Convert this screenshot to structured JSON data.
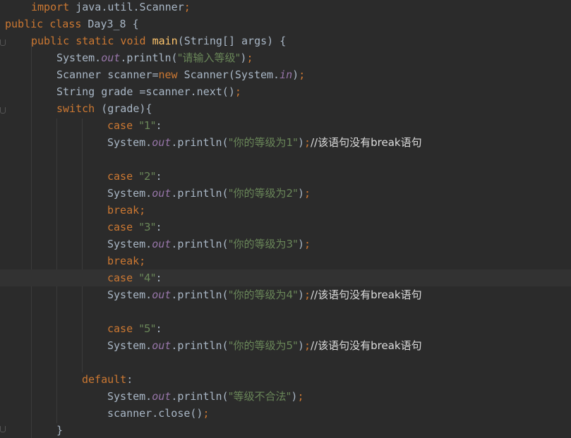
{
  "editor": {
    "lines": [
      {
        "indent": 44,
        "tokens": [
          {
            "t": "kw",
            "v": "import "
          },
          {
            "t": "p",
            "v": "java.util.Scanner"
          },
          {
            "t": "kw",
            "v": ";"
          }
        ]
      },
      {
        "indent": 7,
        "tokens": [
          {
            "t": "kw",
            "v": "public class "
          },
          {
            "t": "p",
            "v": "Day3_8 {"
          }
        ]
      },
      {
        "indent": 44,
        "tokens": [
          {
            "t": "kw",
            "v": "public static void "
          },
          {
            "t": "fn",
            "v": "main"
          },
          {
            "t": "p",
            "v": "(String[] args) {"
          }
        ]
      },
      {
        "indent": 80,
        "tokens": [
          {
            "t": "p",
            "v": "System."
          },
          {
            "t": "sf",
            "v": "out"
          },
          {
            "t": "p",
            "v": ".println("
          },
          {
            "t": "str",
            "v": "\"请输入等级\""
          },
          {
            "t": "p",
            "v": ")"
          },
          {
            "t": "kw",
            "v": ";"
          }
        ]
      },
      {
        "indent": 80,
        "tokens": [
          {
            "t": "p",
            "v": "Scanner scanner="
          },
          {
            "t": "kw",
            "v": "new "
          },
          {
            "t": "p",
            "v": "Scanner(System."
          },
          {
            "t": "sf",
            "v": "in"
          },
          {
            "t": "p",
            "v": ")"
          },
          {
            "t": "kw",
            "v": ";"
          }
        ]
      },
      {
        "indent": 80,
        "tokens": [
          {
            "t": "p",
            "v": "String grade =scanner.next()"
          },
          {
            "t": "kw",
            "v": ";"
          }
        ]
      },
      {
        "indent": 80,
        "tokens": [
          {
            "t": "kw",
            "v": "switch "
          },
          {
            "t": "p",
            "v": "(grade){"
          }
        ]
      },
      {
        "indent": 152,
        "tokens": [
          {
            "t": "kw",
            "v": "case "
          },
          {
            "t": "str",
            "v": "\"1\""
          },
          {
            "t": "p",
            "v": ":"
          }
        ]
      },
      {
        "indent": 152,
        "tokens": [
          {
            "t": "p",
            "v": "System."
          },
          {
            "t": "sf",
            "v": "out"
          },
          {
            "t": "p",
            "v": ".println("
          },
          {
            "t": "str",
            "v": "\"你的等级为1\""
          },
          {
            "t": "p",
            "v": ")"
          },
          {
            "t": "kw",
            "v": ";"
          },
          {
            "t": "cmt",
            "v": "//该语句没有break语句"
          }
        ]
      },
      {
        "indent": 152,
        "tokens": []
      },
      {
        "indent": 152,
        "tokens": [
          {
            "t": "kw",
            "v": "case "
          },
          {
            "t": "str",
            "v": "\"2\""
          },
          {
            "t": "p",
            "v": ":"
          }
        ]
      },
      {
        "indent": 152,
        "tokens": [
          {
            "t": "p",
            "v": "System."
          },
          {
            "t": "sf",
            "v": "out"
          },
          {
            "t": "p",
            "v": ".println("
          },
          {
            "t": "str",
            "v": "\"你的等级为2\""
          },
          {
            "t": "p",
            "v": ")"
          },
          {
            "t": "kw",
            "v": ";"
          }
        ]
      },
      {
        "indent": 152,
        "tokens": [
          {
            "t": "kw",
            "v": "break;"
          }
        ]
      },
      {
        "indent": 152,
        "tokens": [
          {
            "t": "kw",
            "v": "case "
          },
          {
            "t": "str",
            "v": "\"3\""
          },
          {
            "t": "p",
            "v": ":"
          }
        ]
      },
      {
        "indent": 152,
        "tokens": [
          {
            "t": "p",
            "v": "System."
          },
          {
            "t": "sf",
            "v": "out"
          },
          {
            "t": "p",
            "v": ".println("
          },
          {
            "t": "str",
            "v": "\"你的等级为3\""
          },
          {
            "t": "p",
            "v": ")"
          },
          {
            "t": "kw",
            "v": ";"
          }
        ]
      },
      {
        "indent": 152,
        "tokens": [
          {
            "t": "kw",
            "v": "break;"
          }
        ]
      },
      {
        "indent": 152,
        "tokens": [
          {
            "t": "kw",
            "v": "case "
          },
          {
            "t": "str",
            "v": "\"4\""
          },
          {
            "t": "p",
            "v": ":"
          }
        ]
      },
      {
        "indent": 152,
        "tokens": [
          {
            "t": "p",
            "v": "System."
          },
          {
            "t": "sf",
            "v": "out"
          },
          {
            "t": "p",
            "v": ".println("
          },
          {
            "t": "str",
            "v": "\"你的等级为4\""
          },
          {
            "t": "p",
            "v": ")"
          },
          {
            "t": "kw",
            "v": ";"
          },
          {
            "t": "cmt",
            "v": "//该语句没有break语句"
          }
        ]
      },
      {
        "indent": 152,
        "tokens": []
      },
      {
        "indent": 152,
        "tokens": [
          {
            "t": "kw",
            "v": "case "
          },
          {
            "t": "str",
            "v": "\"5\""
          },
          {
            "t": "p",
            "v": ":"
          }
        ]
      },
      {
        "indent": 152,
        "tokens": [
          {
            "t": "p",
            "v": "System."
          },
          {
            "t": "sf",
            "v": "out"
          },
          {
            "t": "p",
            "v": ".println("
          },
          {
            "t": "str",
            "v": "\"你的等级为5\""
          },
          {
            "t": "p",
            "v": ")"
          },
          {
            "t": "kw",
            "v": ";"
          },
          {
            "t": "cmt",
            "v": "//该语句没有break语句"
          }
        ]
      },
      {
        "indent": 116,
        "tokens": []
      },
      {
        "indent": 116,
        "tokens": [
          {
            "t": "kw",
            "v": "default"
          },
          {
            "t": "p",
            "v": ":"
          }
        ]
      },
      {
        "indent": 152,
        "tokens": [
          {
            "t": "p",
            "v": "System."
          },
          {
            "t": "sf",
            "v": "out"
          },
          {
            "t": "p",
            "v": ".println("
          },
          {
            "t": "str",
            "v": "\"等级不合法\""
          },
          {
            "t": "p",
            "v": ")"
          },
          {
            "t": "kw",
            "v": ";"
          }
        ]
      },
      {
        "indent": 152,
        "tokens": [
          {
            "t": "p",
            "v": "scanner.close()"
          },
          {
            "t": "kw",
            "v": ";"
          }
        ]
      },
      {
        "indent": 80,
        "tokens": [
          {
            "t": "p",
            "v": "}"
          }
        ]
      }
    ],
    "current_line": 16
  },
  "colors": {
    "background": "#2b2b2b",
    "keyword": "#cc7832",
    "string": "#6a8759",
    "static_field": "#9876aa",
    "function": "#ffc66d",
    "plain": "#a9b7c6",
    "comment_text": "#dddddd",
    "current_line": "#323232"
  }
}
